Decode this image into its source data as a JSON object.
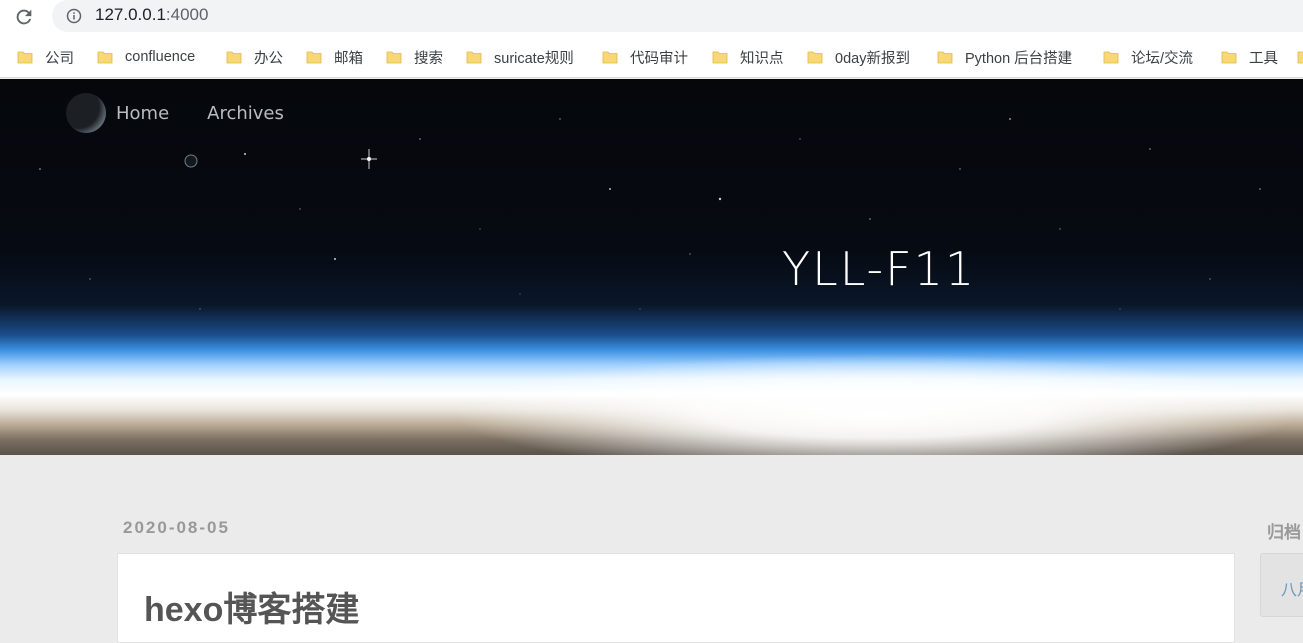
{
  "browser": {
    "url_host": "127.0.0.1",
    "url_port": ":4000",
    "bookmarks": [
      {
        "label": "公司"
      },
      {
        "label": "confluence"
      },
      {
        "label": "办公"
      },
      {
        "label": "邮箱"
      },
      {
        "label": "搜索"
      },
      {
        "label": "suricate规则"
      },
      {
        "label": "代码审计"
      },
      {
        "label": "知识点"
      },
      {
        "label": "0day新报到"
      },
      {
        "label": "Python 后台搭建"
      },
      {
        "label": "论坛/交流"
      },
      {
        "label": "工具"
      }
    ]
  },
  "hero": {
    "nav": [
      {
        "label": "Home"
      },
      {
        "label": "Archives"
      }
    ],
    "site_title": "YLL-F11"
  },
  "post": {
    "date": "2020-08-05",
    "title": "hexo博客搭建"
  },
  "sidebar": {
    "title": "归档",
    "item": "八月"
  },
  "colors": {
    "page_bg": "#ebebeb",
    "folder_icon": "#f8d775",
    "link_blue": "#6b98b9"
  }
}
